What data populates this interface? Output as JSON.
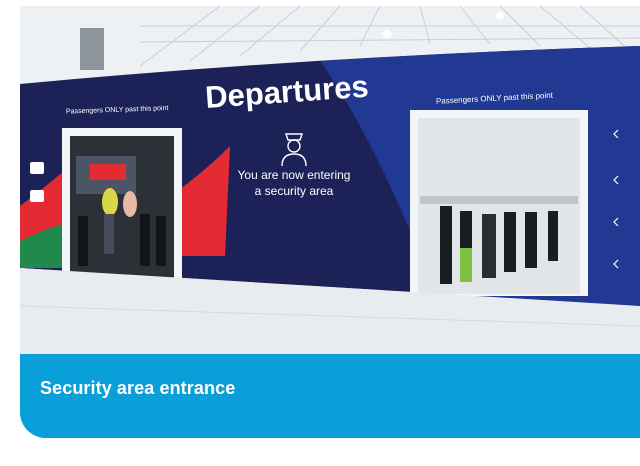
{
  "photo": {
    "alt": "Airport departures security entrance with two doorways in a dark blue wall",
    "sign_title": "Departures",
    "passengers_only_left": "Passengers ONLY past this point",
    "passengers_only_right": "Passengers ONLY past this point",
    "notice_line1": "You are now entering",
    "notice_line2": "a security area",
    "colors": {
      "wall_navy": "#1c2258",
      "wall_blue": "#243c9a",
      "accent_red": "#e42a33",
      "accent_green": "#1f8a4c",
      "floor": "#e9ecef"
    }
  },
  "caption": {
    "text": "Security area entrance",
    "band_color": "#0a9fd8"
  }
}
